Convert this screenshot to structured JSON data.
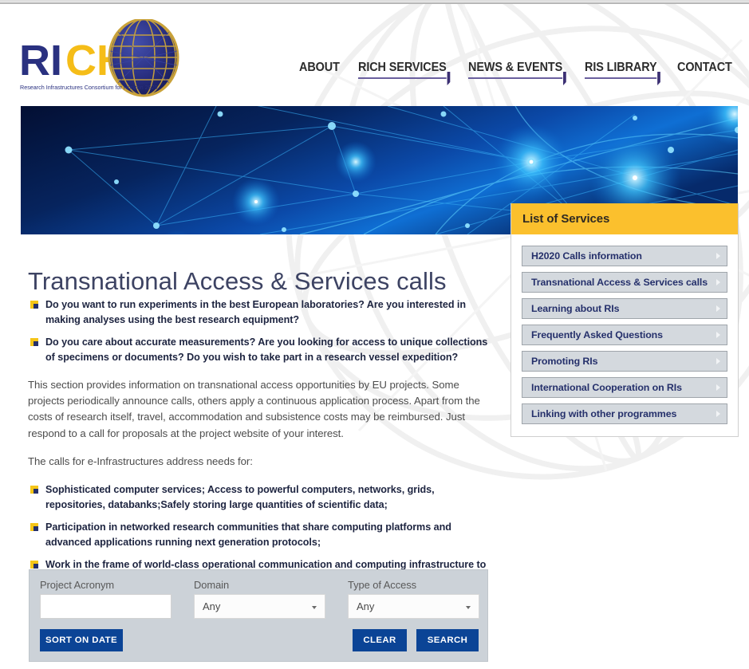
{
  "site": {
    "logo_text_ri": "RI",
    "logo_text_c": "C",
    "logo_text_h": "H",
    "logo_tagline": "Research Infrastructures Consortium for Horizon 2020"
  },
  "nav": {
    "items": [
      {
        "label": "ABOUT",
        "has_submenu": false
      },
      {
        "label": "RICH SERVICES",
        "has_submenu": true
      },
      {
        "label": "NEWS & EVENTS",
        "has_submenu": true
      },
      {
        "label": "RIS LIBRARY",
        "has_submenu": true
      },
      {
        "label": "CONTACT",
        "has_submenu": false
      }
    ]
  },
  "hero": {
    "alt": "abstract blue network nodes banner"
  },
  "main": {
    "title": "Transnational Access & Services calls",
    "intro_bullets": [
      "Do you want to run experiments in the best European laboratories? Are you interested in making analyses using the best research equipment?",
      "Do you care about accurate measurements? Are you looking for access to unique collections of specimens or documents? Do you wish to take part in a research vessel expedition?"
    ],
    "paragraph": "This section provides information on transnational access opportunities by EU projects. Some projects periodically announce calls, others apply a continuous application process. Apart from the costs of research itself, travel, accommodation and subsistence costs may be reimbursed. Just respond to a call for proposals at the project website of your interest.",
    "lead": "The calls for e-Infrastructures address needs for:",
    "needs_bullets": [
      "Sophisticated computer services; Access to powerful computers, networks, grids, repositories, databanks;Safely storing large quantities of scientific data;",
      "Participation in networked research communities that share computing platforms and advanced applications running next generation protocols;",
      "Work in the frame of world-class operational communication and computing infrastructure to facilitate scientific research."
    ]
  },
  "sidebar": {
    "title": "List of Services",
    "items": [
      {
        "label": "H2020 Calls information"
      },
      {
        "label": "Transnational Access & Services calls"
      },
      {
        "label": "Learning about RIs"
      },
      {
        "label": "Frequently Asked Questions"
      },
      {
        "label": "Promoting RIs"
      },
      {
        "label": "International Cooperation on RIs"
      },
      {
        "label": "Linking with other programmes"
      }
    ]
  },
  "search_form": {
    "project_acronym": {
      "label": "Project Acronym",
      "value": "",
      "placeholder": ""
    },
    "domain": {
      "label": "Domain",
      "value": "Any"
    },
    "type_of_access": {
      "label": "Type of Access",
      "value": "Any"
    },
    "sort_button": "SORT ON DATE",
    "clear_button": "CLEAR",
    "search_button": "SEARCH"
  },
  "colors": {
    "accent_yellow": "#fbc02d",
    "brand_blue": "#25306b",
    "button_blue": "#0b4496",
    "panel_grey": "#ccd2d8",
    "title_navy": "#3d4363"
  }
}
